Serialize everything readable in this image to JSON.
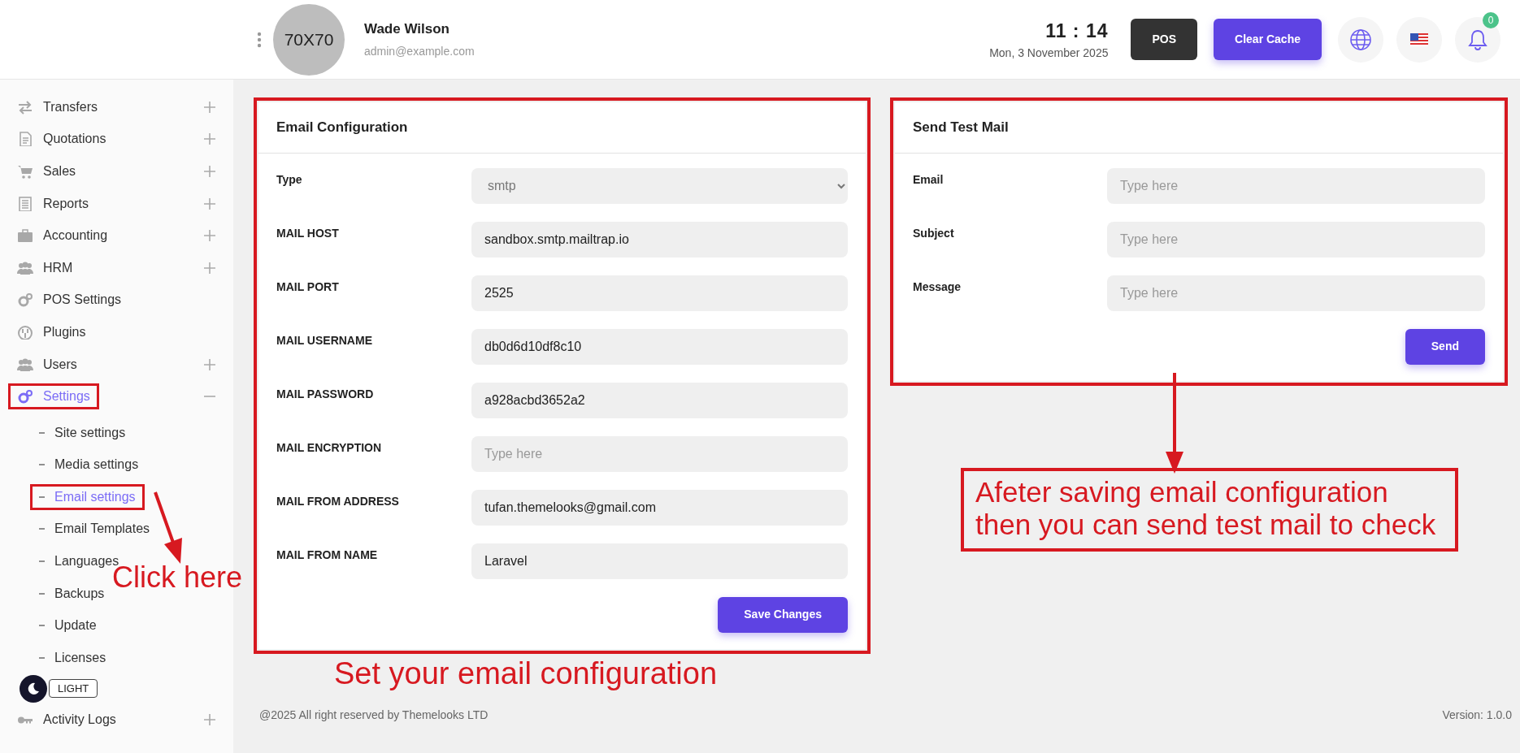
{
  "header": {
    "avatar_text": "70X70",
    "user_name": "Wade Wilson",
    "user_email": "admin@example.com",
    "clock": {
      "time": "11 : 14",
      "date": "Mon, 3 November 2025"
    },
    "buttons": [
      {
        "label": "POS",
        "kind": "dark"
      },
      {
        "label": "Clear Cache",
        "kind": "primary"
      }
    ],
    "notification_count": "0"
  },
  "sidebar": {
    "items": [
      {
        "label": "Transfers",
        "expandable": true,
        "expanded": false,
        "selected": false,
        "highlighted": false
      },
      {
        "label": "Quotations",
        "expandable": true,
        "expanded": false,
        "selected": false,
        "highlighted": false
      },
      {
        "label": "Sales",
        "expandable": true,
        "expanded": false,
        "selected": false,
        "highlighted": false
      },
      {
        "label": "Reports",
        "expandable": true,
        "expanded": false,
        "selected": false,
        "highlighted": false
      },
      {
        "label": "Accounting",
        "expandable": true,
        "expanded": false,
        "selected": false,
        "highlighted": false
      },
      {
        "label": "HRM",
        "expandable": true,
        "expanded": false,
        "selected": false,
        "highlighted": false
      },
      {
        "label": "POS Settings",
        "expandable": false,
        "selected": false,
        "highlighted": false
      },
      {
        "label": "Plugins",
        "expandable": false,
        "selected": false,
        "highlighted": false
      },
      {
        "label": "Users",
        "expandable": true,
        "expanded": false,
        "selected": false,
        "highlighted": false
      },
      {
        "label": "Settings",
        "expandable": true,
        "expanded": true,
        "selected": true,
        "highlighted": true,
        "children": [
          {
            "label": "Site settings",
            "selected": false,
            "highlighted": false
          },
          {
            "label": "Media settings",
            "selected": false,
            "highlighted": false
          },
          {
            "label": "Email settings",
            "selected": true,
            "highlighted": true
          },
          {
            "label": "Email Templates",
            "selected": false,
            "highlighted": false
          },
          {
            "label": "Languages",
            "selected": false,
            "highlighted": false
          },
          {
            "label": "Backups",
            "selected": false,
            "highlighted": false
          },
          {
            "label": "Update",
            "selected": false,
            "highlighted": false
          },
          {
            "label": "Licenses",
            "selected": false,
            "highlighted": false
          }
        ]
      },
      {
        "label": "Activity Logs",
        "expandable": true,
        "expanded": false,
        "selected": false,
        "highlighted": false
      }
    ],
    "theme_toggle": {
      "label": "LIGHT"
    }
  },
  "email_configuration": {
    "title": "Email Configuration",
    "highlighted": true,
    "fields": [
      {
        "label": "Type",
        "kind": "select",
        "value": "smtp"
      },
      {
        "label": "MAIL HOST",
        "kind": "input",
        "value": "sandbox.smtp.mailtrap.io"
      },
      {
        "label": "MAIL PORT",
        "kind": "input",
        "value": "2525"
      },
      {
        "label": "MAIL USERNAME",
        "kind": "input",
        "value": "db0d6d10df8c10"
      },
      {
        "label": "MAIL PASSWORD",
        "kind": "input",
        "value": "a928acbd3652a2"
      },
      {
        "label": "MAIL ENCRYPTION",
        "kind": "input",
        "placeholder": "Type here"
      },
      {
        "label": "MAIL FROM ADDRESS",
        "kind": "input",
        "value": "tufan.themelooks@gmail.com"
      },
      {
        "label": "MAIL FROM NAME",
        "kind": "input",
        "value": "Laravel"
      }
    ],
    "button": "Save Changes"
  },
  "send_test_mail": {
    "title": "Send Test Mail",
    "highlighted": true,
    "fields": [
      {
        "label": "Email",
        "kind": "input",
        "placeholder": "Type here"
      },
      {
        "label": "Subject",
        "kind": "input",
        "placeholder": "Type here"
      },
      {
        "label": "Message",
        "kind": "input",
        "placeholder": "Type here"
      }
    ],
    "button": "Send"
  },
  "footer": {
    "copyright": "@2025 All right reserved by ",
    "company": "Themelooks LTD",
    "version": "Version: 1.0.0"
  },
  "annotations": {
    "click_note": "Click here",
    "config_note": "Set your email configuration",
    "test_note": "Afeter saving email configuration then you can send test mail to check"
  }
}
